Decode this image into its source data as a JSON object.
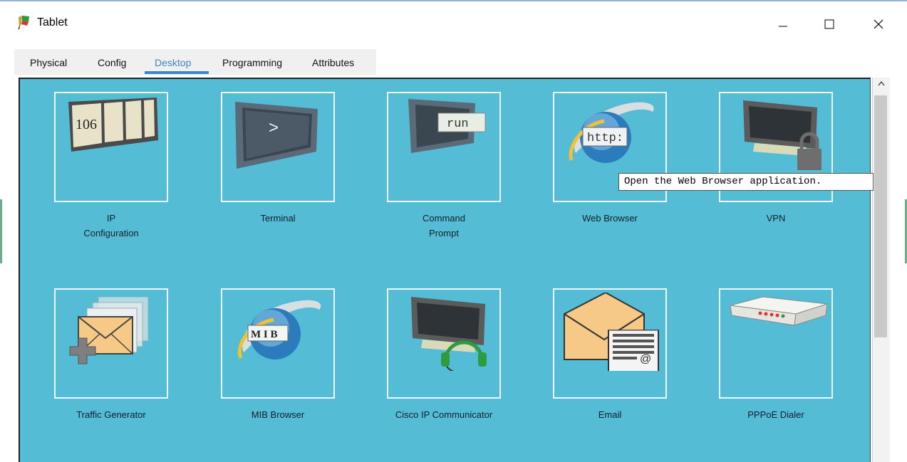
{
  "window": {
    "title": "Tablet",
    "app_icon": "packet-tracer-icon",
    "controls": {
      "minimize": "minimize-icon",
      "maximize": "maximize-icon",
      "close": "close-icon"
    }
  },
  "tabs": [
    {
      "label": "Physical"
    },
    {
      "label": "Config"
    },
    {
      "label": "Desktop",
      "active": true
    },
    {
      "label": "Programming"
    },
    {
      "label": "Attributes"
    }
  ],
  "apps": [
    {
      "label_1": "IP",
      "label_2": "Configuration",
      "icon": "ip-configuration-icon",
      "icon_text": "106"
    },
    {
      "label_1": "Terminal",
      "icon": "terminal-icon",
      "icon_text": ">"
    },
    {
      "label_1": "Command",
      "label_2": "Prompt",
      "icon": "command-prompt-icon",
      "icon_text": "run"
    },
    {
      "label_1": "Web Browser",
      "icon": "web-browser-icon",
      "icon_text": "http:"
    },
    {
      "label_1": "VPN",
      "icon": "vpn-icon"
    },
    {
      "label_1": "Traffic Generator",
      "icon": "traffic-generator-icon"
    },
    {
      "label_1": "MIB Browser",
      "icon": "mib-browser-icon",
      "icon_text": "M I B"
    },
    {
      "label_1": "Cisco IP Communicator",
      "icon": "cisco-ip-communicator-icon"
    },
    {
      "label_1": "Email",
      "icon": "email-icon",
      "icon_text": "@"
    },
    {
      "label_1": "PPPoE Dialer",
      "icon": "pppoe-dialer-icon"
    }
  ],
  "tooltip": {
    "text": "Open the Web Browser application."
  },
  "colors": {
    "desktop_bg": "#55bcd6",
    "tab_active": "#3b87c5",
    "tile_border": "#ecf7fb"
  }
}
